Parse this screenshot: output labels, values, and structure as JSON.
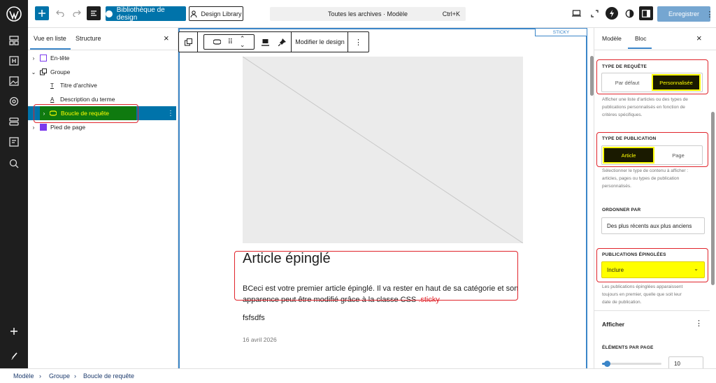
{
  "topbar": {
    "design_library_btn": "Bibliothèque de design",
    "design_library_ext": "Design Library",
    "command_title": "Toutes les archives · Modèle",
    "shortcut": "Ctrl+K",
    "save": "Enregistrer"
  },
  "listview": {
    "tabs": [
      "Vue en liste",
      "Structure"
    ],
    "items": [
      {
        "label": "En-tête"
      },
      {
        "label": "Groupe"
      },
      {
        "label": "Titre d'archive"
      },
      {
        "label": "Description du terme"
      },
      {
        "label": "Boucle de requête"
      },
      {
        "label": "Pied de page"
      }
    ]
  },
  "canvas": {
    "sticky_tag": "STICKY",
    "toolbar_edit_design": "Modifier le design",
    "post_title": "Article épinglé",
    "excerpt_line1": "BCeci est votre premier article épinglé. Il va rester en haut de sa catégorie et son",
    "excerpt_line2_a": "apparence peut être modifié grâce à la classe CSS ",
    "excerpt_line2_b": ".sticky",
    "content_text": "fsfsdfs",
    "date": "16 avril 2026"
  },
  "sidebar": {
    "tabs": [
      "Modèle",
      "Bloc"
    ],
    "query_type_label": "TYPE DE REQUÊTE",
    "query_type_options": [
      "Par défaut",
      "Personnalisée"
    ],
    "query_type_help": [
      "Afficher une liste d'articles ou des types de",
      "publications personnalisés en fonction de",
      "critères spécifiques."
    ],
    "post_type_label": "TYPE DE PUBLICATION",
    "post_type_options": [
      "Article",
      "Page"
    ],
    "post_type_help": [
      "Sélectionner le type de contenu à afficher :",
      "articles, pages ou types de publication",
      "personnalisés."
    ],
    "order_label": "ORDONNER PAR",
    "order_value": "Des plus récents aux plus anciens",
    "sticky_label": "PUBLICATIONS ÉPINGLÉES",
    "sticky_value": "Inclure",
    "sticky_help": [
      "Les publications épinglées apparaissent",
      "toujours en premier, quelle que soit leur",
      "date de publication."
    ],
    "display_heading": "Afficher",
    "per_page_label": "ÉLÉMENTS PAR PAGE",
    "per_page_value": "10",
    "per_page_fraction": 0.08
  },
  "breadcrumb": [
    "Modèle",
    "Groupe",
    "Boucle de requête"
  ],
  "colors": {
    "accent": "#0073aa",
    "highlight_yellow": "#ffff00",
    "selected_dark": "#1a1a00",
    "list_selected_bg": "#0f7a0f",
    "annotation_red": "#e0242b"
  }
}
